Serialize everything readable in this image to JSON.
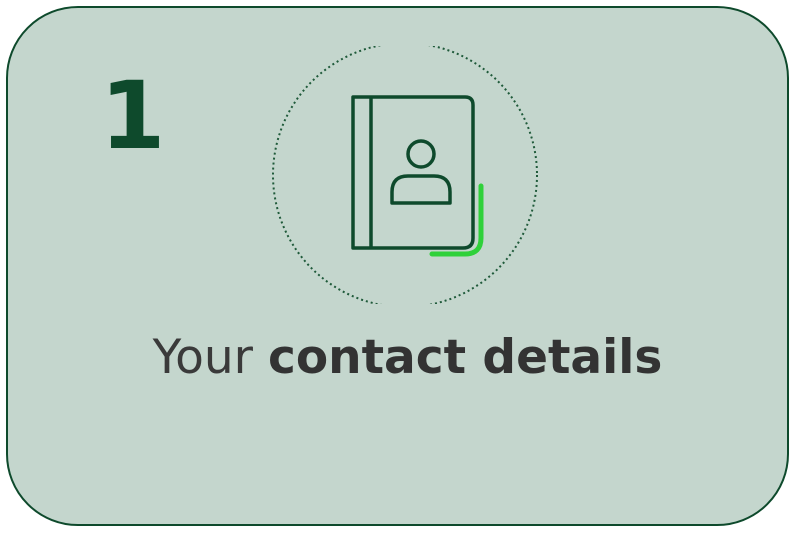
{
  "card": {
    "step_number": "1",
    "title_regular": "Your",
    "title_bold": "contact details",
    "icon": "address-book-icon"
  },
  "colors": {
    "card_background": "#c4d6cd",
    "card_border": "#0e4a2c",
    "icon_stroke": "#0e4a2c",
    "accent": "#2fd13a",
    "text": "#333333"
  }
}
